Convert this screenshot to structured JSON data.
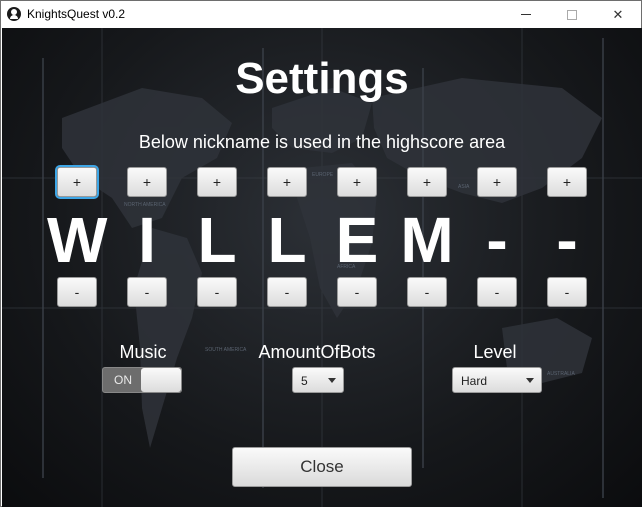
{
  "window": {
    "title": "KnightsQuest v0.2"
  },
  "heading": "Settings",
  "subheading": "Below nickname is used in the highscore area",
  "nickname": {
    "plus_label": "+",
    "minus_label": "-",
    "letters": [
      "W",
      "I",
      "L",
      "L",
      "E",
      "M",
      "-",
      "-"
    ]
  },
  "music": {
    "label": "Music",
    "toggle_text": "ON"
  },
  "bots": {
    "label": "AmountOfBots",
    "value": "5"
  },
  "level": {
    "label": "Level",
    "value": "Hard"
  },
  "close_label": "Close",
  "map_labels": [
    "NORTH AMERICA",
    "EUROPE",
    "AFRICA",
    "SOUTH AMERICA",
    "AUSTRALIA",
    "ASIA"
  ]
}
